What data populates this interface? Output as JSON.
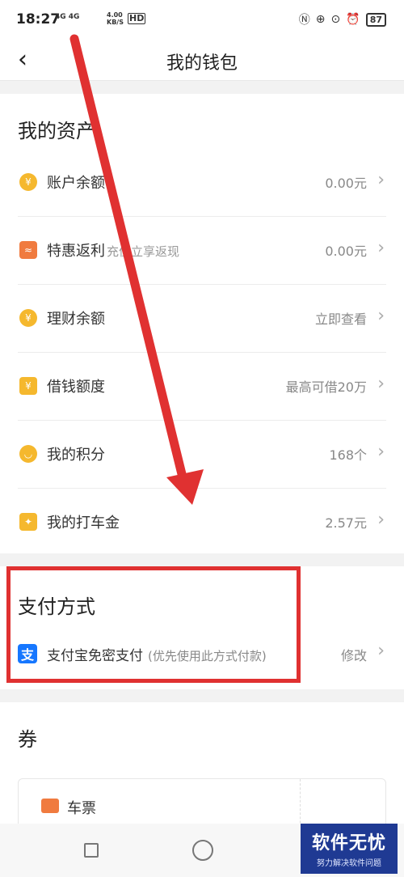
{
  "status_bar": {
    "time": "18:27",
    "network": "4G 4G",
    "speed_value": "4.00",
    "speed_unit": "KB/S",
    "hd": "HD",
    "battery": "87"
  },
  "navbar": {
    "back_icon": "chevron-left-icon",
    "title": "我的钱包"
  },
  "assets": {
    "title": "我的资产",
    "rows": [
      {
        "icon": "piggy-bank-icon",
        "color": "#f5b82e",
        "label": "账户余额",
        "sub": "",
        "value": "0.00元"
      },
      {
        "icon": "rebate-icon",
        "color": "#f07b3f",
        "label": "特惠返利",
        "sub": "充值立享返现",
        "value": "0.00元"
      },
      {
        "icon": "money-bag-icon",
        "color": "#f5b82e",
        "label": "理财余额",
        "sub": "",
        "value": "立即查看"
      },
      {
        "icon": "yen-card-icon",
        "color": "#f5b82e",
        "label": "借钱额度",
        "sub": "",
        "value": "最高可借20万"
      },
      {
        "icon": "points-icon",
        "color": "#f5b82e",
        "label": "我的积分",
        "sub": "",
        "value": "168个"
      },
      {
        "icon": "red-envelope-icon",
        "color": "#f5b82e",
        "label": "我的打车金",
        "sub": "",
        "value": "2.57元"
      }
    ]
  },
  "payment": {
    "title": "支付方式",
    "method_icon": "alipay-icon",
    "method_icon_char": "支",
    "method_label": "支付宝免密支付",
    "method_note": "(优先使用此方式付款)",
    "edit_label": "修改",
    "alipay_color": "#1677ff"
  },
  "coupons": {
    "title": "券",
    "ticket_label": "车票"
  },
  "watermark": {
    "main": "软件无忧",
    "sub": "努力解决软件问题"
  },
  "annotation_color": "#e03131"
}
